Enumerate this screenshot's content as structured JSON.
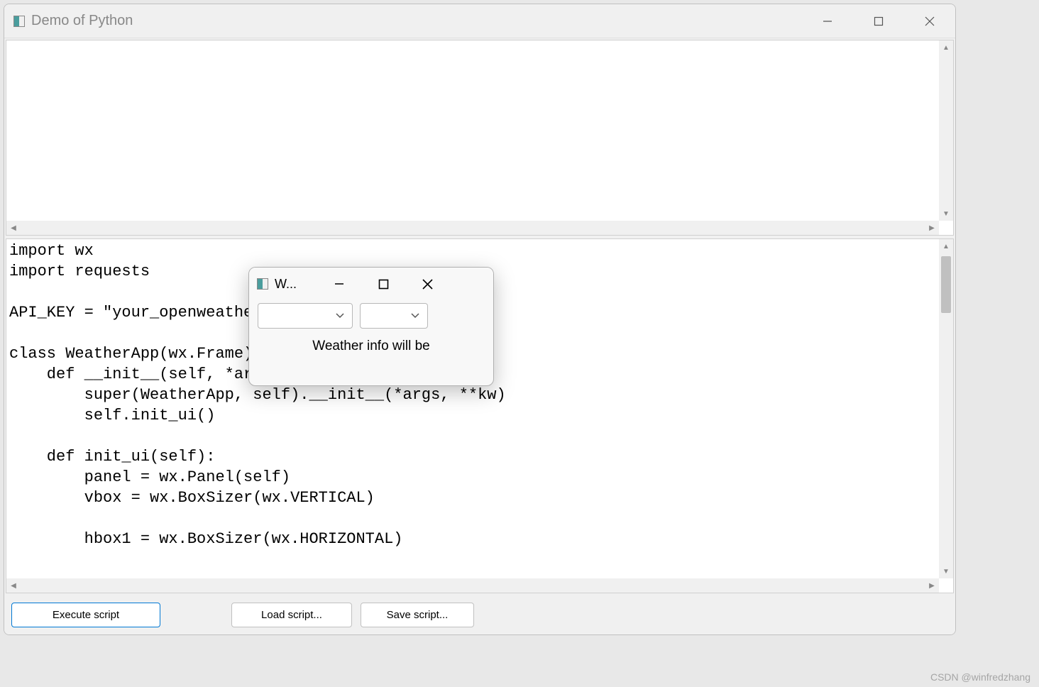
{
  "main_window": {
    "title": "Demo of Python",
    "buttons": {
      "execute": "Execute script",
      "load": "Load script...",
      "save": "Save script..."
    }
  },
  "code": "import wx\nimport requests\n\nAPI_KEY = \"your_openweather\n\nclass WeatherApp(wx.Frame):\n    def __init__(self, *args\n        super(WeatherApp, self).__init__(*args, **kw)\n        self.init_ui()\n\n    def init_ui(self):\n        panel = wx.Panel(self)\n        vbox = wx.BoxSizer(wx.VERTICAL)\n\n        hbox1 = wx.BoxSizer(wx.HORIZONTAL)",
  "child_window": {
    "title": "W...",
    "info_label": "Weather info will be"
  },
  "watermark": "CSDN @winfredzhang"
}
